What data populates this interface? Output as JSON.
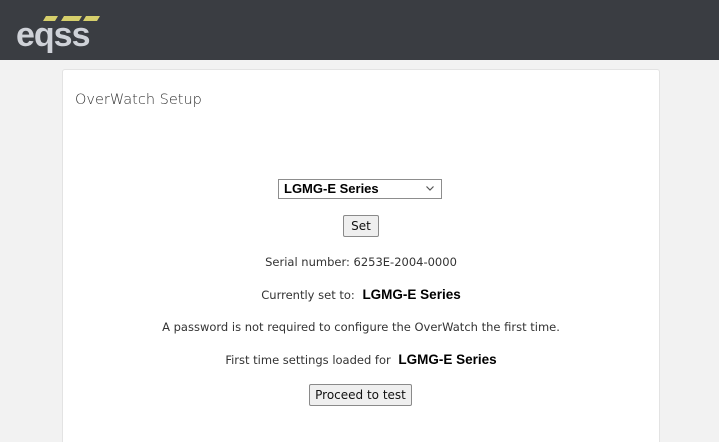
{
  "header": {
    "logo_text": "eqss"
  },
  "setup": {
    "title": "OverWatch Setup",
    "series_select_value": "LGMG-E Series",
    "set_button_label": "Set",
    "serial_label": "Serial number:",
    "serial_value": "6253E-2004-0000",
    "current_label": "Currently set to:",
    "current_value": "LGMG-E Series",
    "password_notice": "A password is not required to configure the OverWatch the first time.",
    "loaded_label": "First time settings loaded for",
    "loaded_value": "LGMG-E Series",
    "proceed_button_label": "Proceed to test"
  },
  "colors": {
    "header_bg": "#3a3d42",
    "logo_text": "#cfd2d8",
    "logo_accent": "#d6cf6b",
    "page_bg": "#f2f2f2"
  }
}
